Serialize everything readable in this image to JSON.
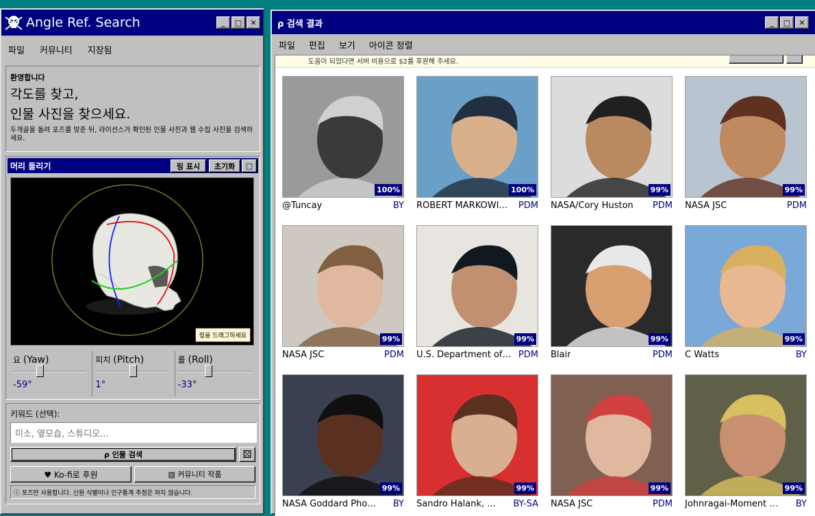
{
  "left_window": {
    "title": "Angle Ref. Search",
    "menu": [
      "파일",
      "커뮤니티",
      "지장됨"
    ],
    "welcome": {
      "heading": "환영합니다",
      "line1": "각도를 찾고,",
      "line2": "인물 사진을 찾으세요.",
      "desc": "두개골을 돌려 포즈를 맞춘 뒤, 라이선스가 확인된 인물 사진과 웹 수집 사진을 검색하세요."
    },
    "head_panel": {
      "title": "머리 돌리기",
      "ring_button": "링 표시",
      "reset_button": "초기화",
      "drag_hint": "링을 드래그하세요"
    },
    "sliders": [
      {
        "label_ko": "요",
        "label_en": "(Yaw)",
        "value": "-59°",
        "pos": 0.34
      },
      {
        "label_ko": "피치",
        "label_en": "(Pitch)",
        "value": "1°",
        "pos": 0.5
      },
      {
        "label_ko": "롤",
        "label_en": "(Roll)",
        "value": "-33°",
        "pos": 0.4
      }
    ],
    "search": {
      "keyword_label": "키워드 (선택):",
      "keyword_placeholder": "미소, 옆모습, 스튜디오...",
      "search_button": "ρ 인물 검색",
      "kofi_button": "♥ Ko-fi로 후원",
      "community_button": "▧ 커뮤니티 작품",
      "notice": "ⓘ 포즈만 사용합니다. 신원 식별이나 인구통계 추정은 하지 않습니다."
    }
  },
  "right_window": {
    "title": "ρ 검색 결과",
    "menu": [
      "파일",
      "편집",
      "보기",
      "아이콘 정렬"
    ],
    "donate_text": "도움이 되었다면 서버 비용으로 $2를 후원해 주세요.",
    "results": [
      {
        "author": "@Tuncay",
        "license": "BY",
        "score": "100%"
      },
      {
        "author": "ROBERT MARKOWI...",
        "license": "PDM",
        "score": "100%"
      },
      {
        "author": "NASA/Cory Huston",
        "license": "PDM",
        "score": "99%"
      },
      {
        "author": "NASA JSC",
        "license": "PDM",
        "score": "99%"
      },
      {
        "author": "NASA JSC",
        "license": "PDM",
        "score": "99%"
      },
      {
        "author": "U.S. Department of ...",
        "license": "PDM",
        "score": "99%"
      },
      {
        "author": "Blair",
        "license": "PDM",
        "score": "99%"
      },
      {
        "author": "C Watts",
        "license": "BY",
        "score": "99%"
      },
      {
        "author": "NASA Goddard Photo...",
        "license": "BY",
        "score": "99%"
      },
      {
        "author": "Sandro Halank, ...",
        "license": "BY-SA",
        "score": "99%"
      },
      {
        "author": "NASA JSC",
        "license": "PDM",
        "score": "99%"
      },
      {
        "author": "Johnragai-Moment Ca...",
        "license": "BY",
        "score": "99%"
      }
    ]
  }
}
